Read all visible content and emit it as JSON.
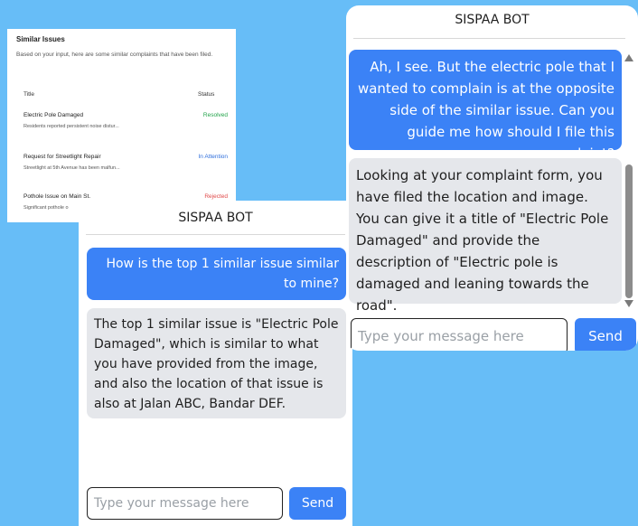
{
  "similar_issues": {
    "title": "Similar Issues",
    "description": "Based on your input, here are some similar complaints that have been filed.",
    "columns": {
      "title": "Title",
      "status": "Status"
    },
    "rows": [
      {
        "title": "Electric Pole Damaged",
        "desc": "Residents reported persistent noise distur...",
        "status": "Resolved",
        "status_color": "#22a34a"
      },
      {
        "title": "Request for Streetlight Repair",
        "desc": "Streetlight at 5th Avenue has been malfun...",
        "status": "In Attention",
        "status_color": "#2f6fdc"
      },
      {
        "title": "Pothole Issue on Main St.",
        "desc": "Significant pothole o",
        "status": "Rejected",
        "status_color": "#e04848"
      }
    ]
  },
  "chat_front": {
    "header": "SISPAA BOT",
    "user_message": "How is the top 1 similar issue similar to mine?",
    "bot_message": "The top 1 similar issue is \"Electric Pole Damaged\", which is similar to what you have provided from the image, and also the location of that issue is also at Jalan ABC, Bandar DEF.",
    "input_placeholder": "Type your message here",
    "send_label": "Send"
  },
  "chat_right": {
    "header": "SISPAA BOT",
    "user_message": "Ah, I see. But the electric pole that I wanted to complain is at the opposite side of the similar issue. Can you guide me how should I file this complaint?",
    "bot_message": "Looking at your complaint form, you have filed the location and image. You can give it a title of \"Electric Pole Damaged\" and provide the description of \"Electric pole is damaged and leaning towards the road\".",
    "input_placeholder": "Type your message here",
    "send_label": "Send"
  },
  "colors": {
    "background": "#67bdf7",
    "accent": "#3b82f6",
    "bot_bubble": "#e5e7eb"
  }
}
